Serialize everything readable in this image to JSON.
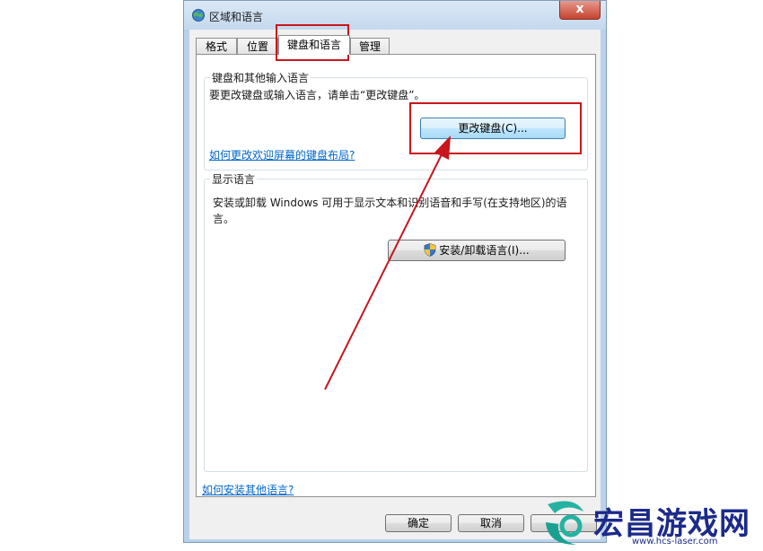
{
  "window": {
    "title": "区域和语言",
    "close_label": "x"
  },
  "tabs": [
    {
      "label": "格式"
    },
    {
      "label": "位置"
    },
    {
      "label": "键盘和语言"
    },
    {
      "label": "管理"
    }
  ],
  "keyboard_group": {
    "legend": "键盘和其他输入语言",
    "description": "要更改键盘或输入语言，请单击“更改键盘”。",
    "change_keyboard_button": "更改键盘(C)...",
    "onscreen_link": "如何更改欢迎屏幕的键盘布局?"
  },
  "display_group": {
    "legend": "显示语言",
    "description_line1": "安装或卸载 Windows 可用于显示文本和识别语音和手写(在支持地区)的语",
    "description_line2": "言。",
    "install_button": "安装/卸载语言(I)..."
  },
  "install_other_link": "如何安装其他语言?",
  "footer": {
    "ok_label": "确定",
    "cancel_label": "取消"
  },
  "watermark": {
    "brand": "宏昌游戏网",
    "url": "www.hcs-laser.com"
  },
  "colors": {
    "annotation_red": "#c8161d",
    "link_blue": "#0066cc",
    "watermark_blue": "#1c2a8a"
  }
}
